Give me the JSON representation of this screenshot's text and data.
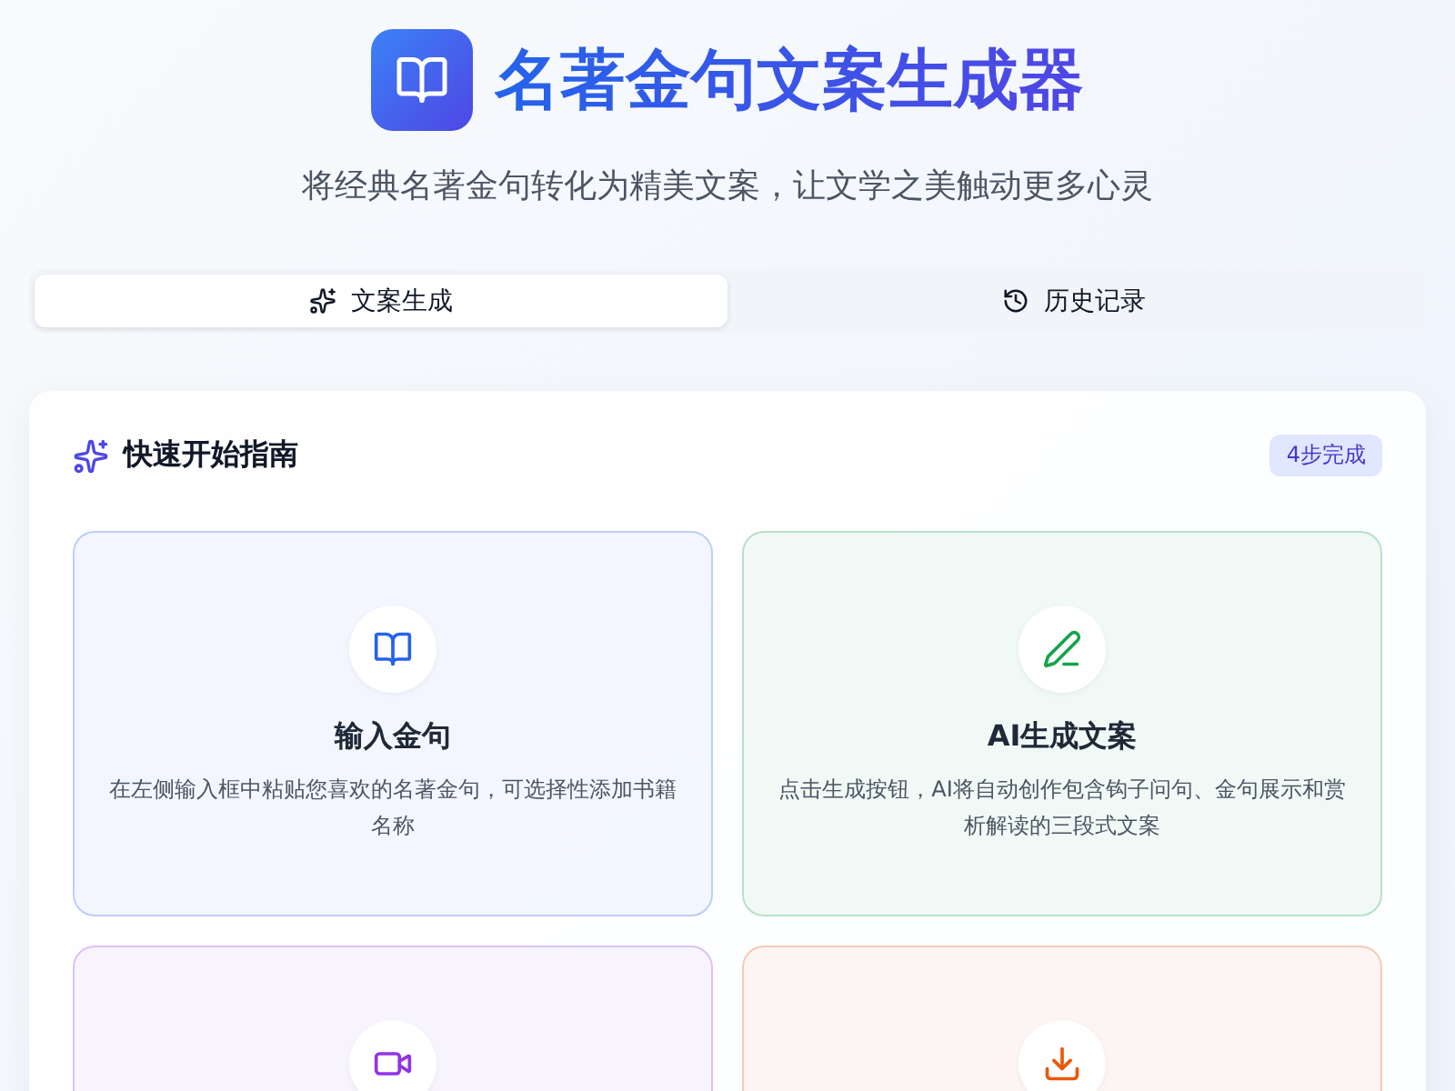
{
  "header": {
    "title": "名著金句文案生成器",
    "subtitle": "将经典名著金句转化为精美文案，让文学之美触动更多心灵"
  },
  "tabs": [
    {
      "label": "文案生成",
      "selected": true
    },
    {
      "label": "历史记录",
      "selected": false
    }
  ],
  "guide": {
    "title": "快速开始指南",
    "badge": "4步完成",
    "steps": [
      {
        "color": "#2563eb",
        "title": "输入金句",
        "description": "在左侧输入框中粘贴您喜欢的名著金句，可选择性添加书籍名称"
      },
      {
        "color": "#16a34a",
        "title": "AI生成文案",
        "description": "点击生成按钮，AI将自动创作包含钩子问句、金句展示和赏析解读的三段式文案"
      },
      {
        "color": "#9333ea"
      },
      {
        "color": "#ea580c"
      }
    ]
  }
}
